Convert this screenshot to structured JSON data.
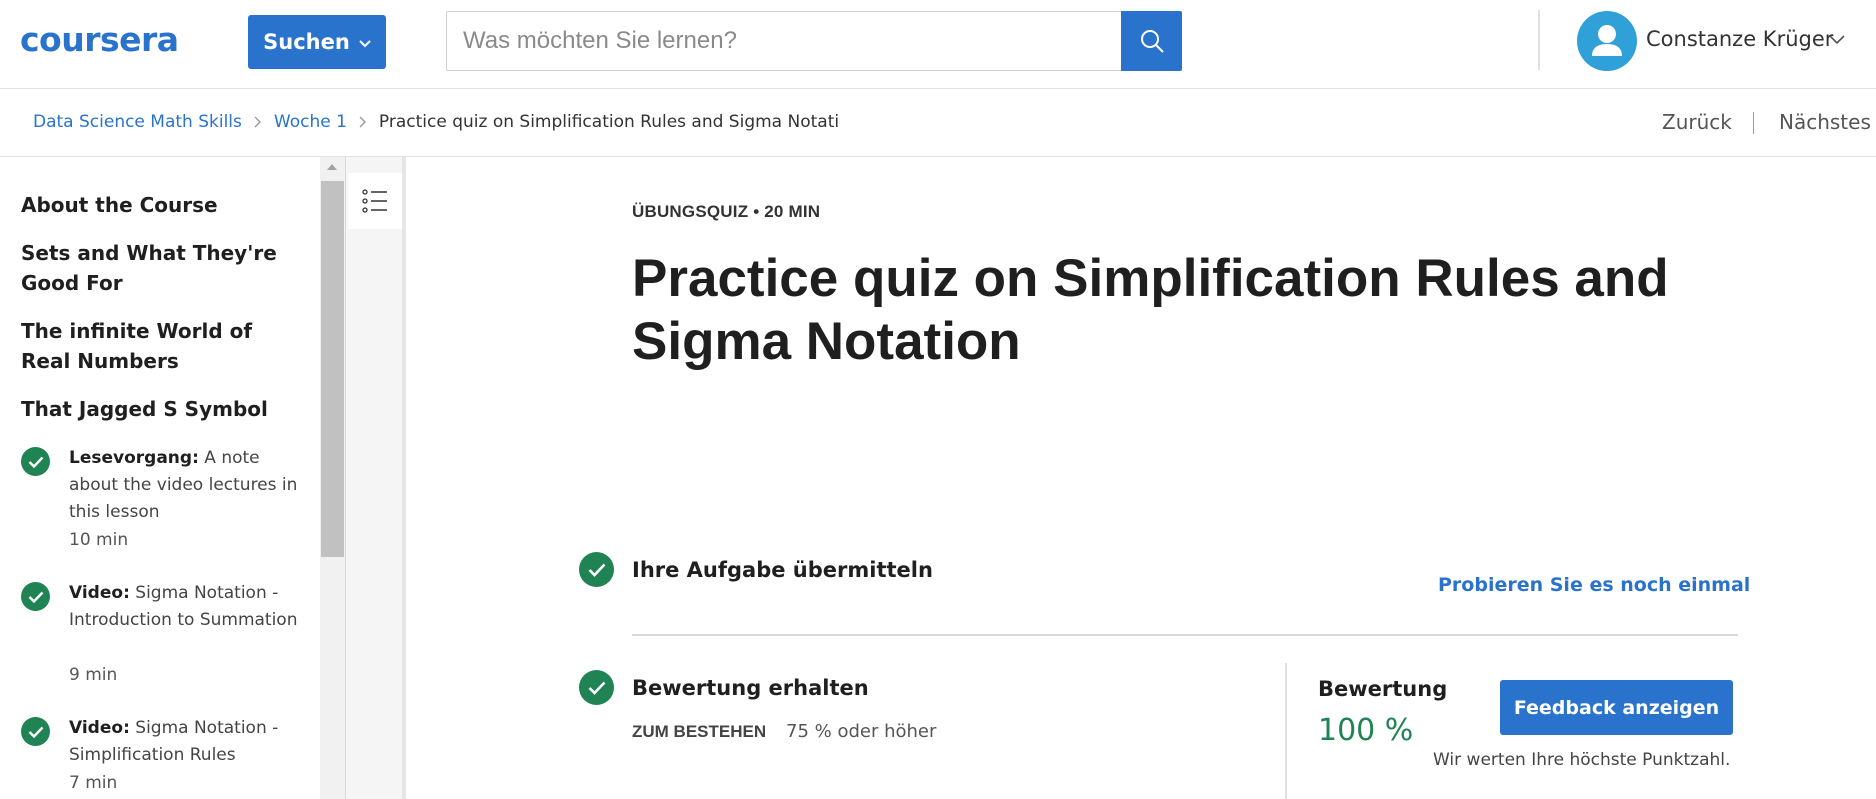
{
  "header": {
    "logo_text": "coursera",
    "explore_label": "Suchen",
    "search_placeholder": "Was möchten Sie lernen?",
    "user_name": "Constanze Krüger"
  },
  "breadcrumb": {
    "items": [
      "Data Science Math Skills",
      "Woche 1"
    ],
    "current": "Practice quiz on Simplification Rules and Sigma Notati"
  },
  "nav": {
    "prev_label": "Zurück",
    "next_label": "Nächstes"
  },
  "sidebar": {
    "sections": [
      "About the Course",
      "Sets and What They're Good For",
      "The infinite World of Real Numbers",
      "That Jagged S Symbol"
    ],
    "items": [
      {
        "type": "Lesevorgang:",
        "title": "A note about the video lectures in this lesson",
        "duration": "10 min"
      },
      {
        "type": "Video:",
        "title": "Sigma Notation - Introduction to Summation",
        "duration": "9 min"
      },
      {
        "type": "Video:",
        "title": "Sigma Notation - Simplification Rules",
        "duration": "7 min"
      }
    ]
  },
  "main": {
    "eyebrow": "ÜBUNGSQUIZ • 20 MIN",
    "title": "Practice quiz on Simplification Rules and Sigma Notation",
    "step1_title": "Ihre Aufgabe übermitteln",
    "retry_label": "Probieren Sie es noch einmal",
    "step2_title": "Bewertung erhalten",
    "pass_label": "ZUM BESTEHEN",
    "pass_value": "75 % oder höher",
    "grade_label": "Bewertung",
    "grade_value": "100 %",
    "feedback_label": "Feedback anzeigen",
    "grade_note": "Wir werten Ihre höchste Punktzahl."
  },
  "colors": {
    "brand": "#0056d2",
    "accent": "#2a73cc",
    "success": "#1f8354"
  }
}
